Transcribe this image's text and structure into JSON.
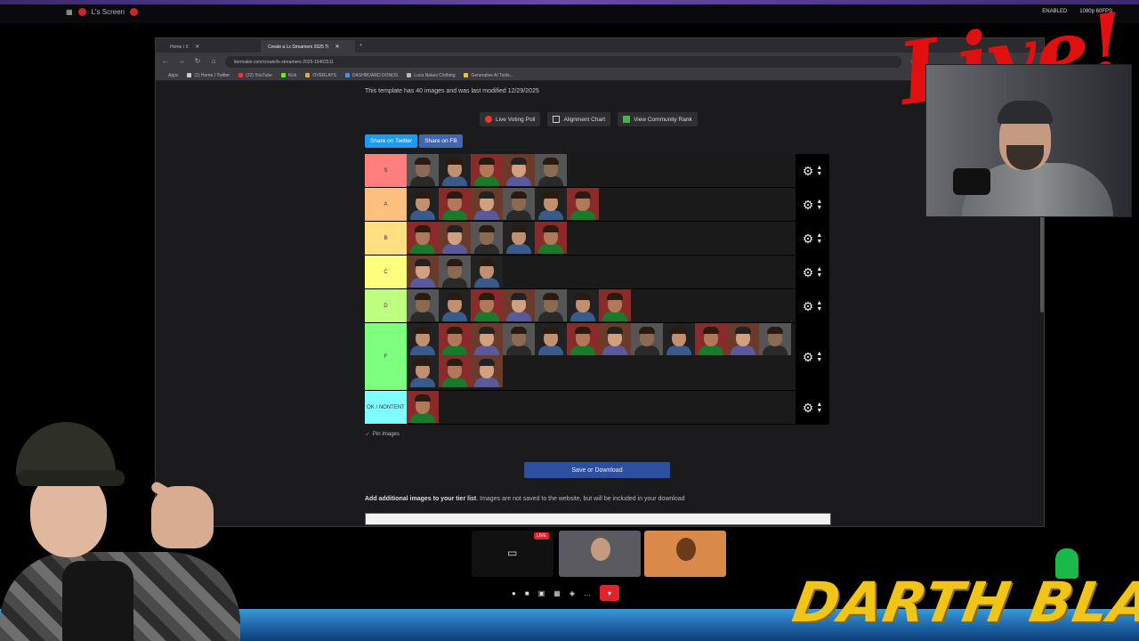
{
  "os_bar": {
    "left_label": "L's Screen",
    "right_items": [
      "ENABLED",
      "1080p 60FPS"
    ]
  },
  "browser": {
    "tabs": [
      {
        "label": "Home / X"
      },
      {
        "label": "Create a Lx Streamers 2025 Ti"
      }
    ],
    "url": "tiermaker.com/create/lx-streamers-2025-16402511",
    "bookmarks": [
      {
        "label": "Apps",
        "color": "#888888"
      },
      {
        "label": "(1) Home / Twitter",
        "color": "#cccccc"
      },
      {
        "label": "(22) YouTube",
        "color": "#e53935"
      },
      {
        "label": "Kick",
        "color": "#53fc18"
      },
      {
        "label": "OVERLAYS",
        "color": "#f5a623"
      },
      {
        "label": "DASHBOARD DONOS",
        "color": "#4a90e2"
      },
      {
        "label": "Luca Nalani Clothing",
        "color": "#bbbbbb"
      },
      {
        "label": "Generative AI Tools...",
        "color": "#f0c418"
      }
    ]
  },
  "page": {
    "template_info": "This template has 40 images and was last modified 12/29/2025",
    "actions": [
      {
        "label": "Live Voting Poll",
        "icon": "live-icon",
        "color": "#e53935"
      },
      {
        "label": "Alignment Chart",
        "icon": "grid-icon",
        "color": "#cccccc"
      },
      {
        "label": "View Community Rank",
        "icon": "rank-icon",
        "color": "#4caf50"
      }
    ],
    "share": [
      {
        "label": "Share on Twitter",
        "color": "#1d9bf0"
      },
      {
        "label": "Share on FB",
        "color": "#4267b2"
      }
    ],
    "tiers": [
      {
        "label": "S",
        "color": "#ff7f7f",
        "count": 5
      },
      {
        "label": "A",
        "color": "#ffbf7f",
        "count": 6
      },
      {
        "label": "B",
        "color": "#ffdf7f",
        "count": 5
      },
      {
        "label": "C",
        "color": "#ffff7f",
        "count": 3
      },
      {
        "label": "D",
        "color": "#bfff7f",
        "count": 7
      },
      {
        "label": "F",
        "color": "#7fff7f",
        "count": 15
      },
      {
        "label": "OK / NONTENT",
        "color": "#7fffff",
        "count": 1
      }
    ],
    "pin_label": "Pin Images",
    "save_label": "Save or Download",
    "add_title_bold": "Add additional images to your tier list",
    "add_title_rest": ". Images are not saved to the website, but will be included in your download"
  },
  "overlay": {
    "live_text": "Live!",
    "brand_text": "DARTH BLAZE"
  },
  "call": {
    "live_badge": "LIVE"
  }
}
